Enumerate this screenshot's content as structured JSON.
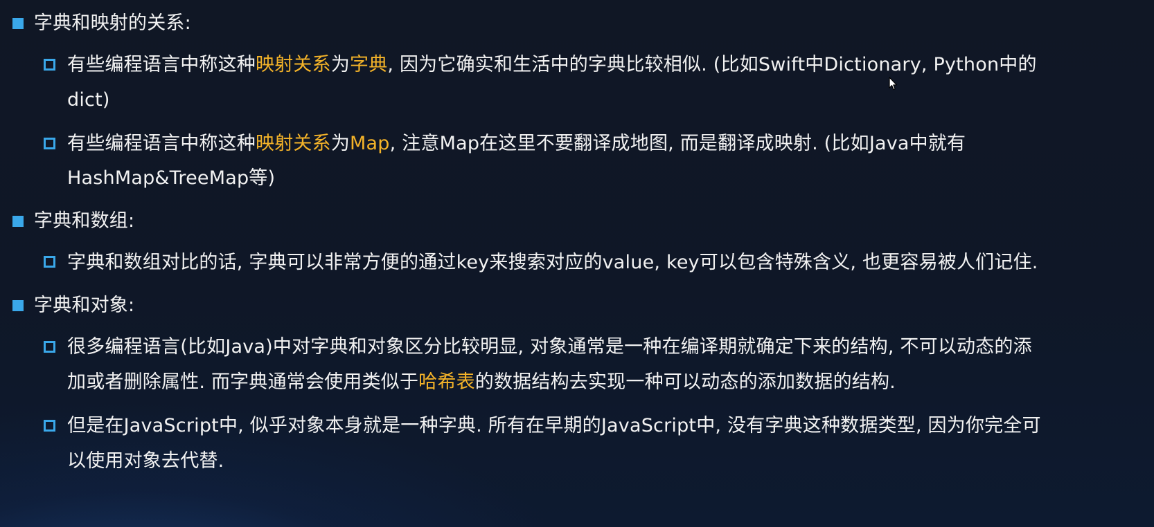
{
  "sections": [
    {
      "heading": "字典和映射的关系:",
      "items": [
        {
          "line1": [
            "有些编程语言中称这种",
            "映射关系",
            "为",
            "字典",
            ", 因为它确实和生活中的字典比较相似. (比如Swift中Dictionary, Python中的"
          ],
          "line2": "dict)"
        },
        {
          "line1": [
            "有些编程语言中称这种",
            "映射关系",
            "为",
            "Map",
            ", 注意Map在这里不要翻译成地图, 而是翻译成映射. (比如Java中就有"
          ],
          "line2": "HashMap&TreeMap等)"
        }
      ]
    },
    {
      "heading": "字典和数组:",
      "items": [
        {
          "line1": "字典和数组对比的话, 字典可以非常方便的通过key来搜索对应的value, key可以包含特殊含义, 也更容易被人们记住."
        }
      ]
    },
    {
      "heading": "字典和对象:",
      "items": [
        {
          "line1": "很多编程语言(比如Java)中对字典和对象区分比较明显, 对象通常是一种在编译期就确定下来的结构, 不可以动态的添",
          "line2": [
            "加或者删除属性. 而字典通常会使用类似于",
            "哈希表",
            "的数据结构去实现一种可以动态的添加数据的结构."
          ]
        },
        {
          "line1": "但是在JavaScript中, 似乎对象本身就是一种字典. 所有在早期的JavaScript中, 没有字典这种数据类型, 因为你完全可",
          "line2": "以使用对象去代替."
        }
      ]
    }
  ],
  "colors": {
    "bullet": "#3aa8ea",
    "highlight": "#f4b329",
    "text": "#f2f2f2"
  },
  "icons": {
    "level1_bullet": "filled-square",
    "level2_bullet": "hollow-square",
    "cursor": "mouse-pointer-arrow"
  }
}
